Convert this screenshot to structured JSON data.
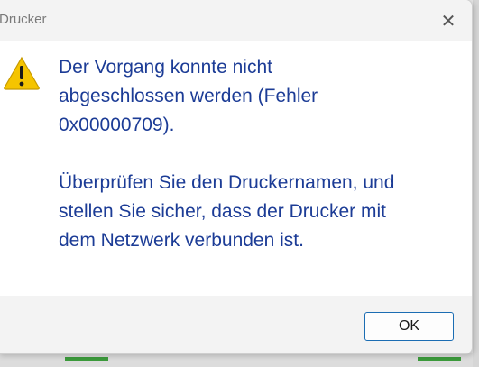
{
  "window": {
    "title": "Drucker",
    "close_glyph": "✕"
  },
  "message": {
    "icon": "warning-icon",
    "line1": "Der Vorgang konnte nicht",
    "line2": "abgeschlossen werden (Fehler",
    "line3": "0x00000709).",
    "line4": "Überprüfen Sie den Druckernamen, und",
    "line5": "stellen Sie sicher, dass der Drucker mit",
    "line6": "dem Netzwerk verbunden ist."
  },
  "footer": {
    "ok_label": "OK"
  },
  "colors": {
    "message_text": "#1c3c96",
    "warning_fill": "#f5c400",
    "button_border": "#1b6db3"
  }
}
